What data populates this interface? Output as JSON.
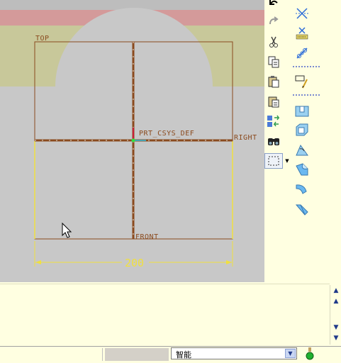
{
  "viewport": {
    "datum_labels": {
      "top": "TOP",
      "right": "RIGHT",
      "front": "FRONT",
      "csys": "PRT_CSYS_DEF"
    },
    "dimension_value": "200"
  },
  "toolbar": {
    "icons": [
      "undo-icon",
      "redo-icon",
      "cut-icon",
      "copy-icon",
      "paste-icon",
      "paste-special-icon",
      "regenerate-icon",
      "find-icon",
      "select-box-icon",
      "datum-axis-icon",
      "datum-plane-icon",
      "datum-chain-icon",
      "sketch-icon",
      "hole-icon",
      "shell-icon",
      "draft-icon",
      "round-icon",
      "chamfer-icon",
      "edge-icon"
    ]
  },
  "statusbar": {
    "filter_value": "智能"
  },
  "colors": {
    "sketch_line": "#8a4a1e",
    "dimension": "#e8e040",
    "plane_band": "#c8c89a",
    "top_band": "#d49a9a"
  }
}
